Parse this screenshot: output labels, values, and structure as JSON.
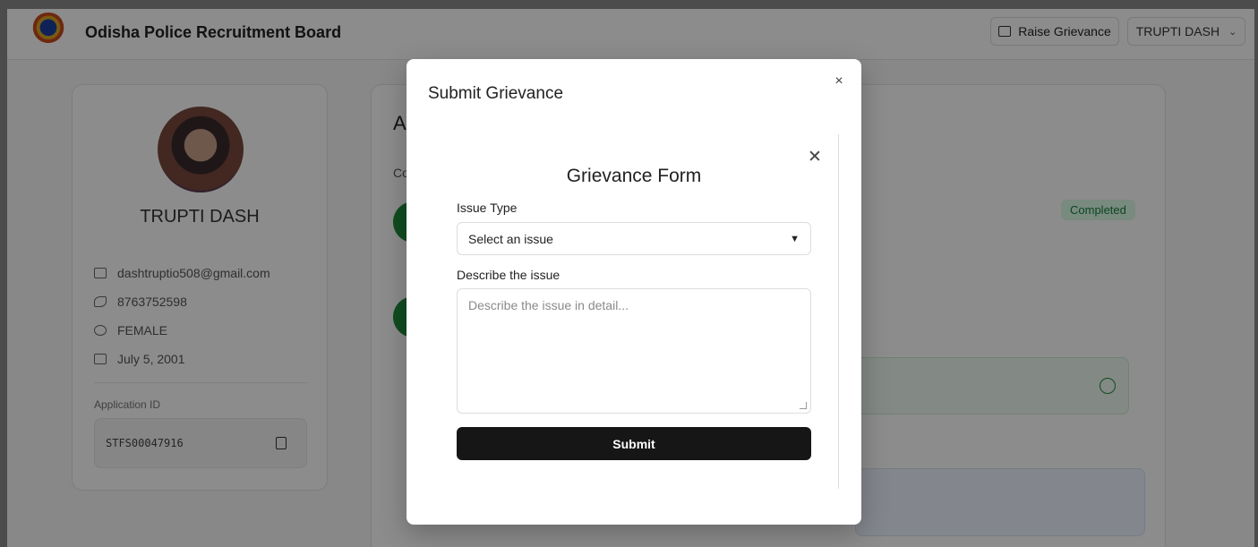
{
  "header": {
    "brand": "Odisha Police Recruitment Board",
    "raise_grievance_label": "Raise Grievance",
    "user_menu_label": "TRUPTI DASH"
  },
  "profile": {
    "name": "TRUPTI DASH",
    "email": "dashtruptio508@gmail.com",
    "phone": "8763752598",
    "gender": "FEMALE",
    "dob": "July 5, 2001",
    "application_id_label": "Application ID",
    "application_id": "STFS00047916"
  },
  "main": {
    "heading_partial": "A",
    "sub_partial": "Co",
    "status_badge": "Completed",
    "status_color": "#15803d"
  },
  "modal": {
    "title": "Submit Grievance",
    "close_glyph": "×",
    "form": {
      "close_glyph": "✕",
      "title": "Grievance Form",
      "issue_type_label": "Issue Type",
      "issue_type_selected": "Select an issue",
      "describe_label": "Describe the issue",
      "describe_placeholder": "Describe the issue in detail...",
      "submit_label": "Submit"
    }
  },
  "icons": {
    "grievance": "chat-bubble-icon",
    "user_menu": "chevron-down-icon",
    "email": "mail-icon",
    "phone": "phone-icon",
    "gender": "user-icon",
    "dob": "calendar-icon",
    "copy": "copy-icon",
    "check": "check-circle-icon"
  }
}
